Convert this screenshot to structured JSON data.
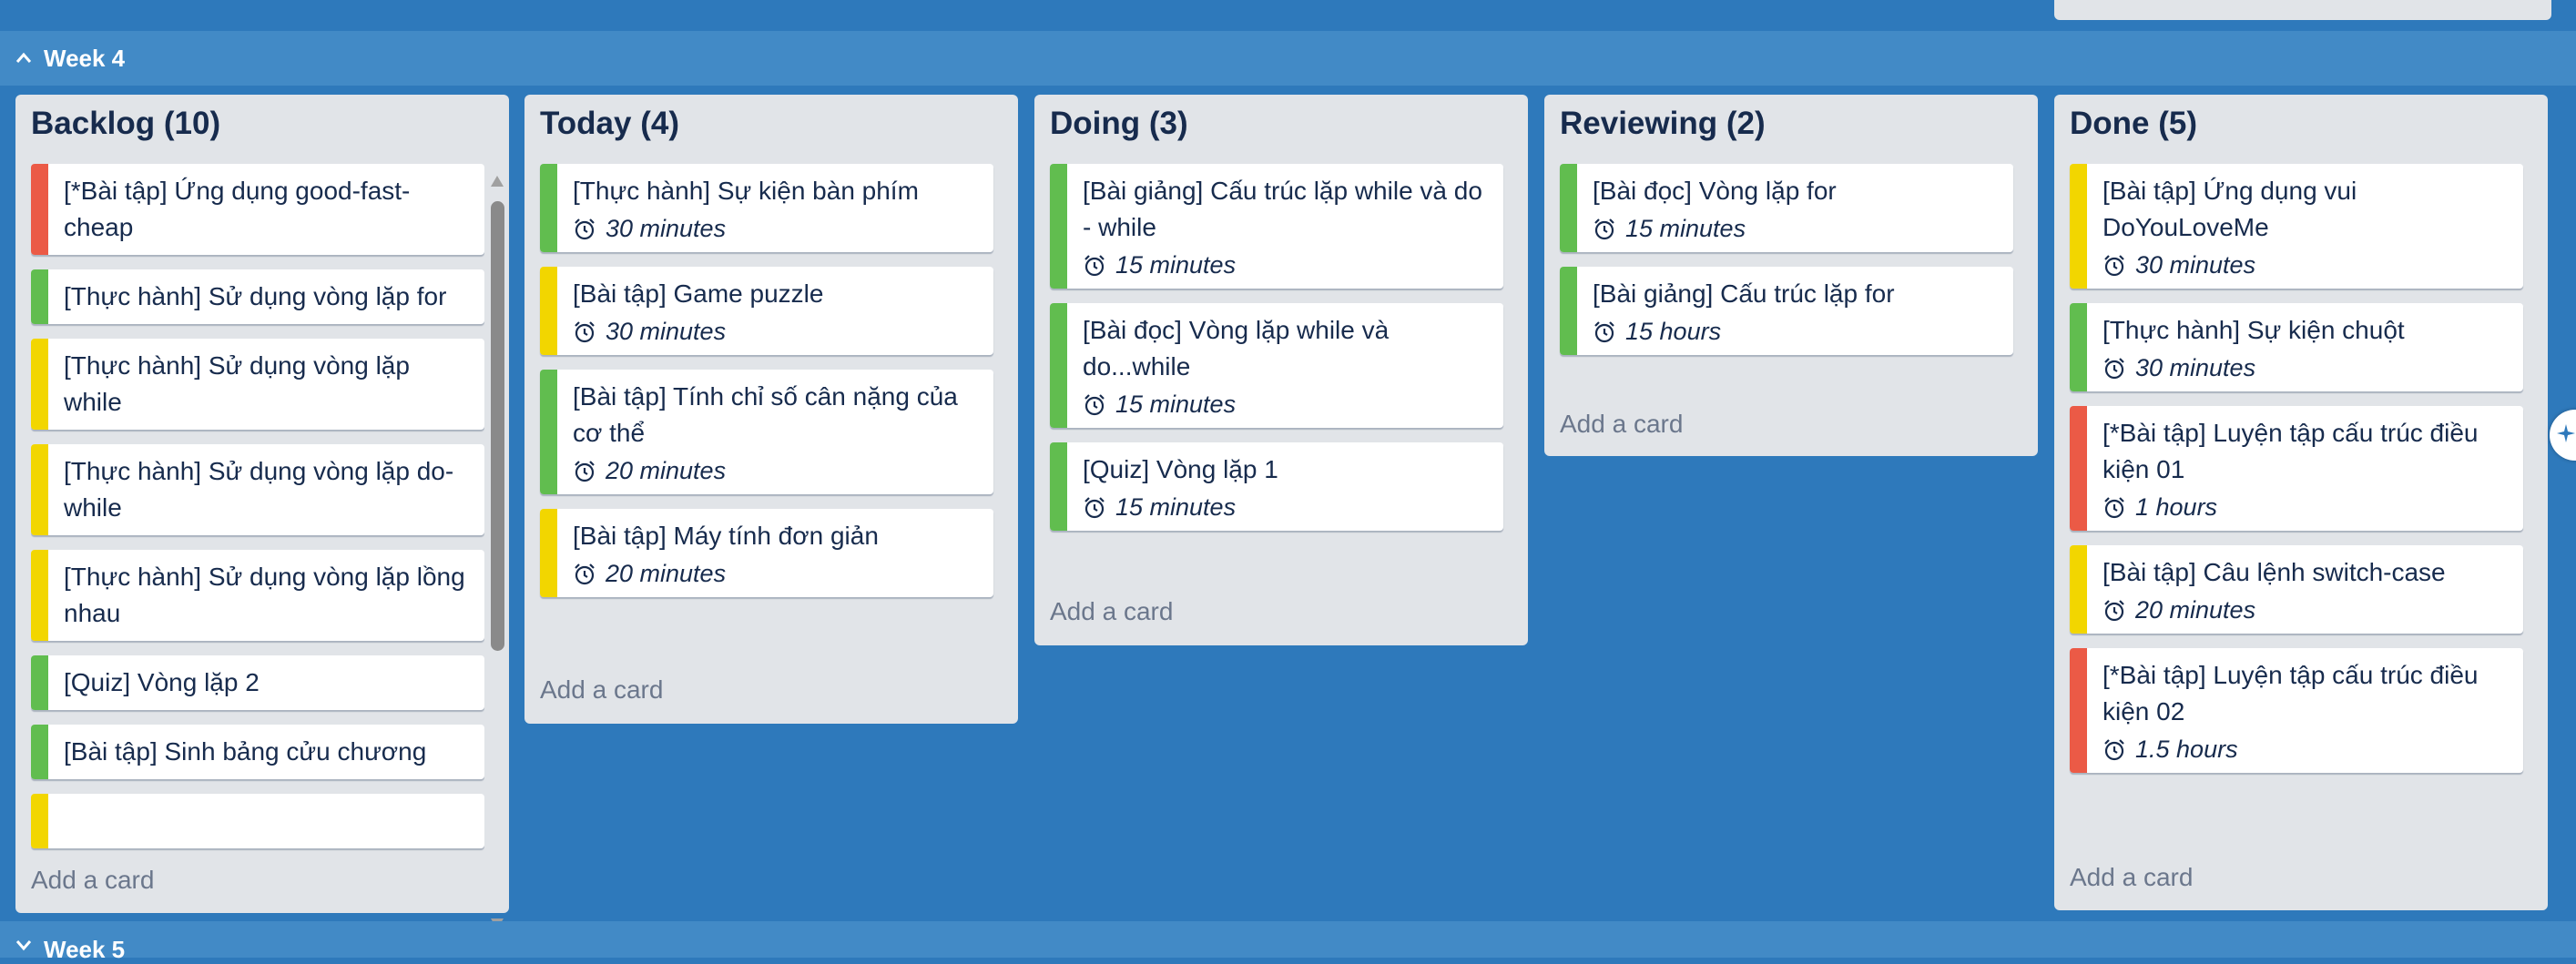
{
  "weeks": [
    {
      "title": "Week 4",
      "expanded": true
    },
    {
      "title": "Week 5",
      "expanded": false
    }
  ],
  "colors": {
    "background": "#2e79bb",
    "header": "#428ac6",
    "list_bg": "#e1e4e8",
    "label_red": "#eb5a46",
    "label_green": "#61bd4f",
    "label_yellow": "#f2d600"
  },
  "lists": [
    {
      "title": "Backlog (10)",
      "add_card": "Add a card",
      "cards": [
        {
          "title": "[*Bài tập] Ứng dụng good-fast-cheap",
          "label": "red",
          "duration": null
        },
        {
          "title": "[Thực hành] Sử dụng vòng lặp for",
          "label": "green",
          "duration": null
        },
        {
          "title": "[Thực hành] Sử dụng vòng lặp while",
          "label": "yellow",
          "duration": null
        },
        {
          "title": "[Thực hành] Sử dụng vòng lặp do-while",
          "label": "yellow",
          "duration": null
        },
        {
          "title": "[Thực hành] Sử dụng vòng lặp lồng nhau",
          "label": "yellow",
          "duration": null
        },
        {
          "title": "[Quiz] Vòng lặp 2",
          "label": "green",
          "duration": null
        },
        {
          "title": "[Bài tập] Sinh bảng cửu chương",
          "label": "green",
          "duration": null
        },
        {
          "title": "",
          "label": "yellow",
          "duration": null
        }
      ]
    },
    {
      "title": "Today (4)",
      "add_card": "Add a card",
      "cards": [
        {
          "title": "[Thực hành] Sự kiện bàn phím",
          "label": "green",
          "duration": "30 minutes"
        },
        {
          "title": "[Bài tập] Game puzzle",
          "label": "yellow",
          "duration": "30 minutes"
        },
        {
          "title": "[Bài tập] Tính chỉ số cân nặng của cơ thể",
          "label": "green",
          "duration": "20 minutes"
        },
        {
          "title": "[Bài tập] Máy tính đơn giản",
          "label": "yellow",
          "duration": "20 minutes"
        }
      ]
    },
    {
      "title": "Doing (3)",
      "add_card": "Add a card",
      "cards": [
        {
          "title": "[Bài giảng] Cấu trúc lặp while và do - while",
          "label": "green",
          "duration": "15 minutes"
        },
        {
          "title": "[Bài đọc] Vòng lặp while và do...while",
          "label": "green",
          "duration": "15 minutes"
        },
        {
          "title": "[Quiz] Vòng lặp 1",
          "label": "green",
          "duration": "15 minutes"
        }
      ]
    },
    {
      "title": "Reviewing (2)",
      "add_card": "Add a card",
      "cards": [
        {
          "title": "[Bài đọc] Vòng lặp for",
          "label": "green",
          "duration": "15 minutes"
        },
        {
          "title": "[Bài giảng] Cấu trúc lặp for",
          "label": "green",
          "duration": "15 hours"
        }
      ]
    },
    {
      "title": "Done (5)",
      "add_card": "Add a card",
      "cards": [
        {
          "title": "[Bài tập] Ứng dụng vui DoYouLoveMe",
          "label": "yellow",
          "duration": "30 minutes"
        },
        {
          "title": "[Thực hành] Sự kiện chuột",
          "label": "green",
          "duration": "30 minutes"
        },
        {
          "title": "[*Bài tập] Luyện tập cấu trúc điều kiện 01",
          "label": "red",
          "duration": "1 hours"
        },
        {
          "title": "[Bài tập] Câu lệnh switch-case",
          "label": "yellow",
          "duration": "20 minutes"
        },
        {
          "title": "[*Bài tập] Luyện tập cấu trúc điều kiện 02",
          "label": "red",
          "duration": "1.5 hours"
        }
      ]
    }
  ]
}
